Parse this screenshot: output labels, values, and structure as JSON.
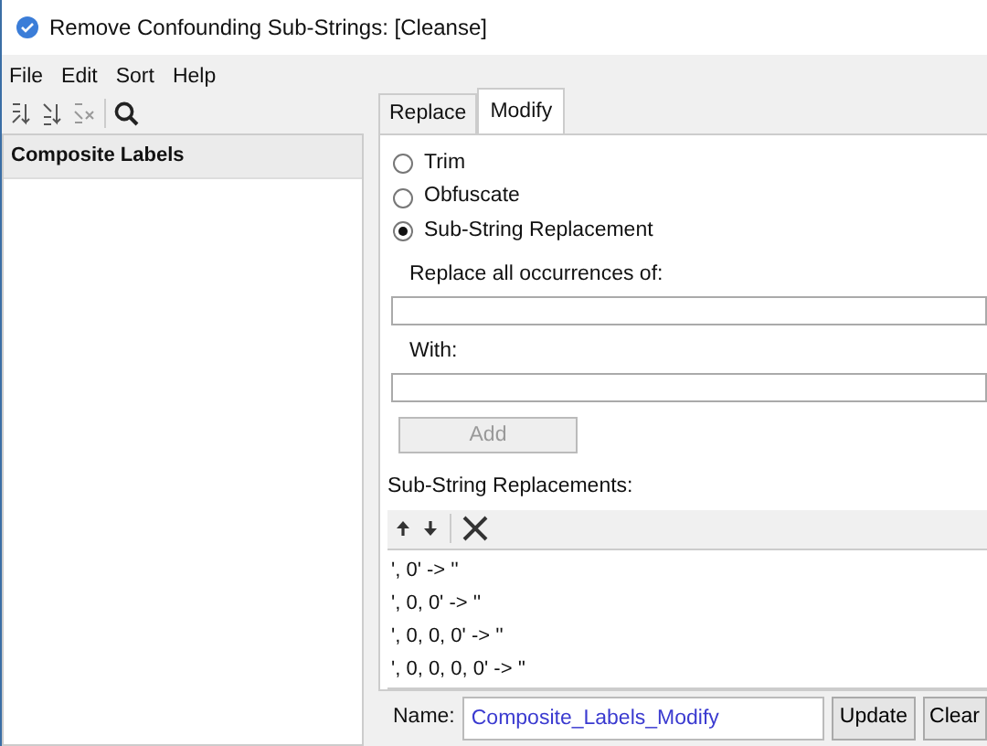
{
  "window": {
    "title": "Remove Confounding Sub-Strings: [Cleanse]"
  },
  "menu": [
    "File",
    "Edit",
    "Sort",
    "Help"
  ],
  "sidebar": {
    "items": [
      {
        "label": "Composite Labels",
        "selected": true
      }
    ]
  },
  "tabs": [
    {
      "label": "Replace",
      "selected": false
    },
    {
      "label": "Modify",
      "selected": true
    }
  ],
  "options": [
    {
      "label": "Trim",
      "selected": false
    },
    {
      "label": "Obfuscate",
      "selected": false
    },
    {
      "label": "Sub-String Replacement",
      "selected": true
    }
  ],
  "replace_label": "Replace all occurrences of:",
  "with_label": "With:",
  "add_button": {
    "label": "Add",
    "disabled": true
  },
  "list_label": "Sub-String Replacements:",
  "replacements": [
    "', 0' -> ''",
    "', 0, 0' -> ''",
    "', 0, 0, 0' -> ''",
    "', 0, 0, 0, 0' -> ''"
  ],
  "name_label": "Name:",
  "name_value": "Composite_Labels_Modify",
  "buttons": [
    "Update",
    "Clear"
  ]
}
